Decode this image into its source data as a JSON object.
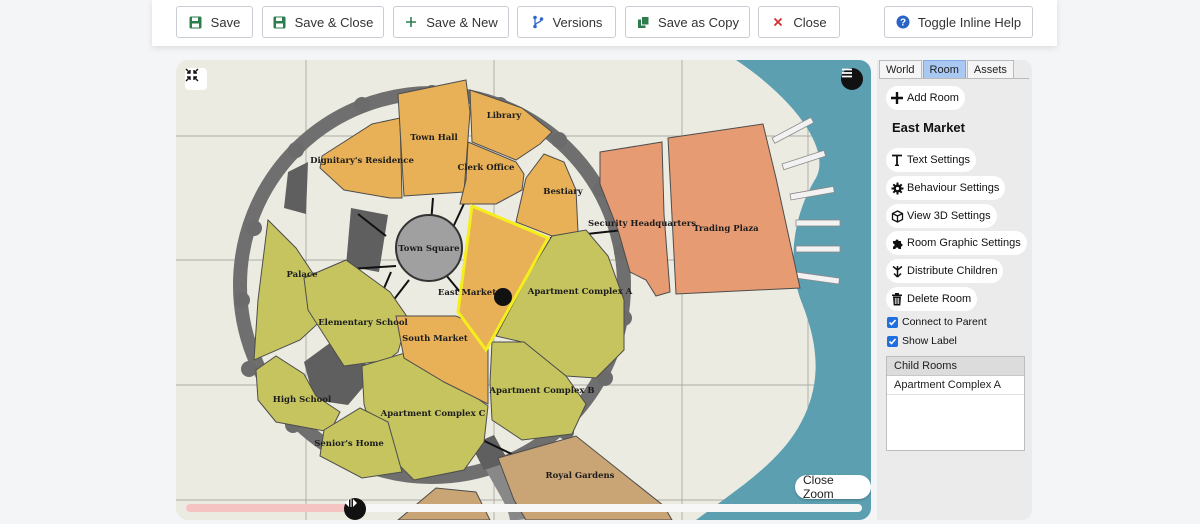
{
  "toolbar": {
    "save": "Save",
    "save_close": "Save & Close",
    "save_new": "Save & New",
    "versions": "Versions",
    "save_copy": "Save as Copy",
    "close": "Close",
    "help": "Toggle Inline Help"
  },
  "map": {
    "labels": {
      "dignitary": "Dignitary's Residence",
      "town_hall": "Town Hall",
      "library": "Library",
      "clerk": "Clerk Office",
      "bestiary": "Bestiary",
      "security": "Security Headquarters",
      "trading": "Trading Plaza",
      "town_square": "Town Square",
      "palace": "Palace",
      "east_market": "East Market",
      "apt_a": "Apartment Complex A",
      "elementary": "Elementary School",
      "south_market": "South Market",
      "high_school": "High School",
      "apt_c": "Apartment Complex C",
      "apt_b": "Apartment Complex B",
      "seniors": "Senior's Home",
      "royal": "Royal Gardens"
    },
    "close_zoom": "Close Zoom",
    "zoom_level": 0.25
  },
  "sidebar": {
    "tabs": [
      "World",
      "Room",
      "Assets"
    ],
    "active_tab": "Room",
    "add_room": "Add Room",
    "room_name": "East Market",
    "text_settings": "Text Settings",
    "behaviour_settings": "Behaviour Settings",
    "view3d_settings": "View 3D Settings",
    "graphic_settings": "Room Graphic Settings",
    "distribute_children": "Distribute Children",
    "delete_room": "Delete Room",
    "connect_parent": "Connect to Parent",
    "show_label": "Show Label",
    "child_header": "Child Rooms",
    "children": [
      "Apartment Complex A"
    ]
  },
  "colors": {
    "orange_room": "#e8b157",
    "salmon_room": "#e79b72",
    "olive_room": "#c5c45f",
    "tan_room": "#c9a474",
    "water": "#5b9fb1",
    "wall": "#707070",
    "selection": "#f5ee1c",
    "active_tab": "#a9c8f2"
  }
}
